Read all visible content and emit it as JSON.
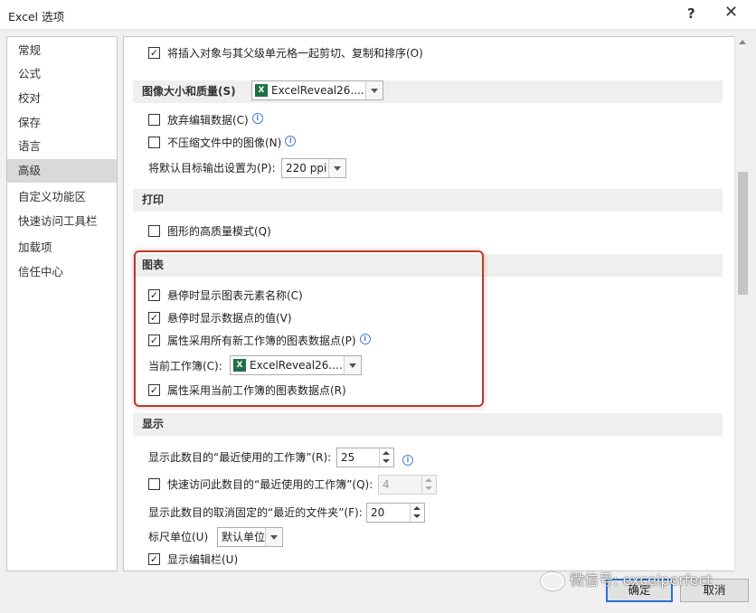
{
  "window": {
    "title": "Excel 选项",
    "help": "?",
    "close": "✕"
  },
  "nav": {
    "items": [
      {
        "label": "常规"
      },
      {
        "label": "公式"
      },
      {
        "label": "校对"
      },
      {
        "label": "保存"
      },
      {
        "label": "语言"
      },
      {
        "label": "高级",
        "active": true
      },
      {
        "label": "自定义功能区"
      },
      {
        "label": "快速访问工具栏"
      },
      {
        "label": "加载项"
      },
      {
        "label": "信任中心"
      }
    ]
  },
  "content": {
    "cut_copy_sort": {
      "label": "将插入对象与其父级单元格一起剪切、复制和排序(O)",
      "checked": true
    },
    "image_section": {
      "title": "图像大小和质量(S)",
      "workbook": "ExcelReveal26...."
    },
    "discard_edit": {
      "label": "放弃编辑数据(C)",
      "checked": false
    },
    "no_compress": {
      "label": "不压缩文件中的图像(N)",
      "checked": false
    },
    "default_output": {
      "label": "将默认目标输出设置为(P):",
      "value": "220 ppi"
    },
    "print_section": {
      "title": "打印"
    },
    "hq_graphics": {
      "label": "图形的高质量模式(Q)",
      "checked": false
    },
    "chart_section": {
      "title": "图表"
    },
    "hover_names": {
      "label": "悬停时显示图表元素名称(C)",
      "checked": true
    },
    "hover_values": {
      "label": "悬停时显示数据点的值(V)",
      "checked": true
    },
    "all_new_wb": {
      "label": "属性采用所有新工作簿的图表数据点(P)",
      "checked": true
    },
    "current_wb": {
      "label": "当前工作簿(C):",
      "value": "ExcelReveal26...."
    },
    "current_wb_points": {
      "label": "属性采用当前工作簿的图表数据点(R)",
      "checked": true
    },
    "display_section": {
      "title": "显示"
    },
    "recent_count": {
      "label": "显示此数目的“最近使用的工作簿”(R):",
      "value": "25"
    },
    "quick_access_recent": {
      "label": "快速访问此数目的“最近使用的工作簿”(Q):",
      "value": "4",
      "checked": false
    },
    "unpinned_folders": {
      "label": "显示此数目的取消固定的“最近的文件夹”(F):",
      "value": "20"
    },
    "ruler_units": {
      "label": "标尺单位(U)",
      "value": "默认单位"
    },
    "formula_bar": {
      "label": "显示编辑栏(U)",
      "checked": true
    }
  },
  "buttons": {
    "ok": "确定",
    "cancel": "取消"
  },
  "watermark": {
    "text": "微信号: excelperfect"
  },
  "colors": {
    "highlight": "#c0392b",
    "excel_green": "#1e7145",
    "ok_border": "#2b6fd6"
  }
}
